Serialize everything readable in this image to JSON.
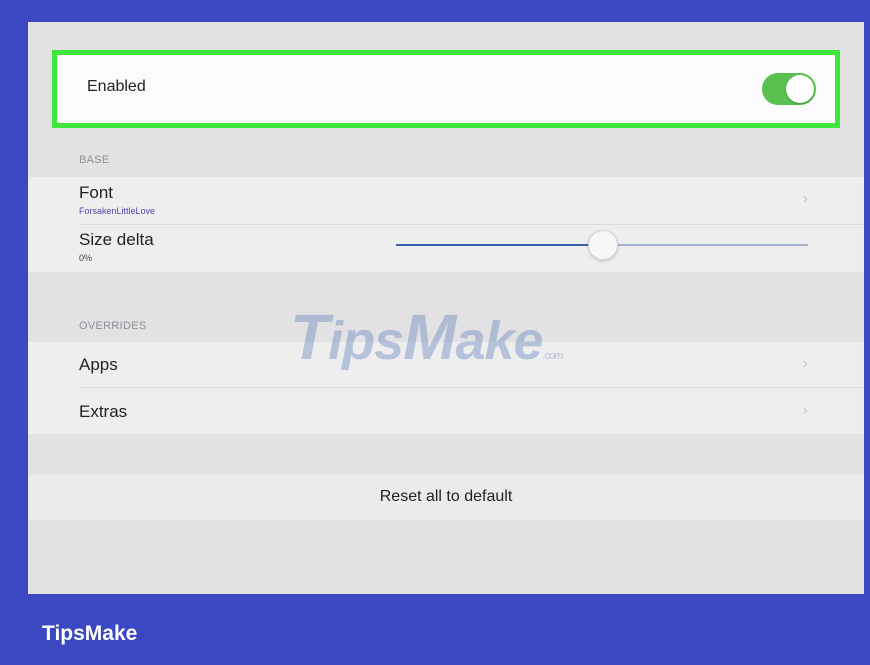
{
  "enabled": {
    "label": "Enabled",
    "toggle_on": true
  },
  "base": {
    "header": "BASE",
    "font": {
      "label": "Font",
      "value": "ForsakenLittleLove",
      "chevron": "›"
    },
    "size_delta": {
      "label": "Size delta",
      "value": "0%",
      "slider_fraction": 0.5
    }
  },
  "overrides": {
    "header": "OVERRIDES",
    "apps_label": "Apps",
    "extras_label": "Extras",
    "chevron": "›"
  },
  "reset": {
    "label": "Reset all to default"
  },
  "watermark": {
    "text_T": "T",
    "text_ips": "ips",
    "text_M": "M",
    "text_ake": "ake",
    "text_com": ".com"
  },
  "brand": {
    "label": "TipsMake"
  },
  "colors": {
    "frame": "#3a48c2",
    "highlight": "#3ee53b",
    "toggle": "#59c14f",
    "accent": "#5a3fb0"
  }
}
